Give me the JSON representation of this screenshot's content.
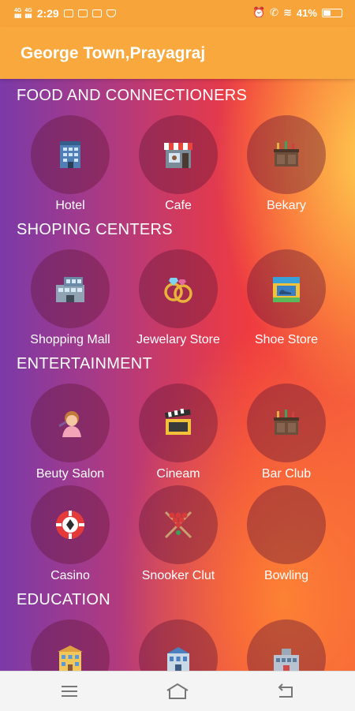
{
  "status_bar": {
    "network_1": "4G",
    "network_2": "4G",
    "time": "2:29",
    "battery": "41%",
    "battery_level": 0.41
  },
  "header": {
    "title": "George Town,Prayagraj"
  },
  "sections": [
    {
      "title": "FOOD AND CONNECTIONERS",
      "items": [
        {
          "label": "Hotel",
          "icon": "hotel-building-icon"
        },
        {
          "label": "Cafe",
          "icon": "cafe-storefront-icon"
        },
        {
          "label": "Bekary",
          "icon": "bakery-counter-icon"
        }
      ]
    },
    {
      "title": "SHOPING CENTERS",
      "items": [
        {
          "label": "Shopping Mall",
          "icon": "shopping-mall-icon"
        },
        {
          "label": "Jewelary Store",
          "icon": "rings-icon"
        },
        {
          "label": "Shoe Store",
          "icon": "shoe-store-icon"
        }
      ]
    },
    {
      "title": "ENTERTAINMENT",
      "items": [
        {
          "label": "Beuty Salon",
          "icon": "salon-icon"
        },
        {
          "label": "Cineam",
          "icon": "clapperboard-icon"
        },
        {
          "label": "Bar Club",
          "icon": "bar-counter-icon"
        },
        {
          "label": "Casino",
          "icon": "casino-chip-icon"
        },
        {
          "label": "Snooker Clut",
          "icon": "snooker-cues-icon"
        },
        {
          "label": "Bowling",
          "icon": ""
        }
      ]
    },
    {
      "title": "EDUCATION",
      "items": [
        {
          "label": "",
          "icon": "school-building-icon"
        },
        {
          "label": "",
          "icon": "college-building-icon"
        },
        {
          "label": "",
          "icon": "institute-building-icon"
        }
      ]
    }
  ],
  "nav": {
    "menu": "menu-icon",
    "home": "home-icon",
    "back": "back-icon"
  }
}
